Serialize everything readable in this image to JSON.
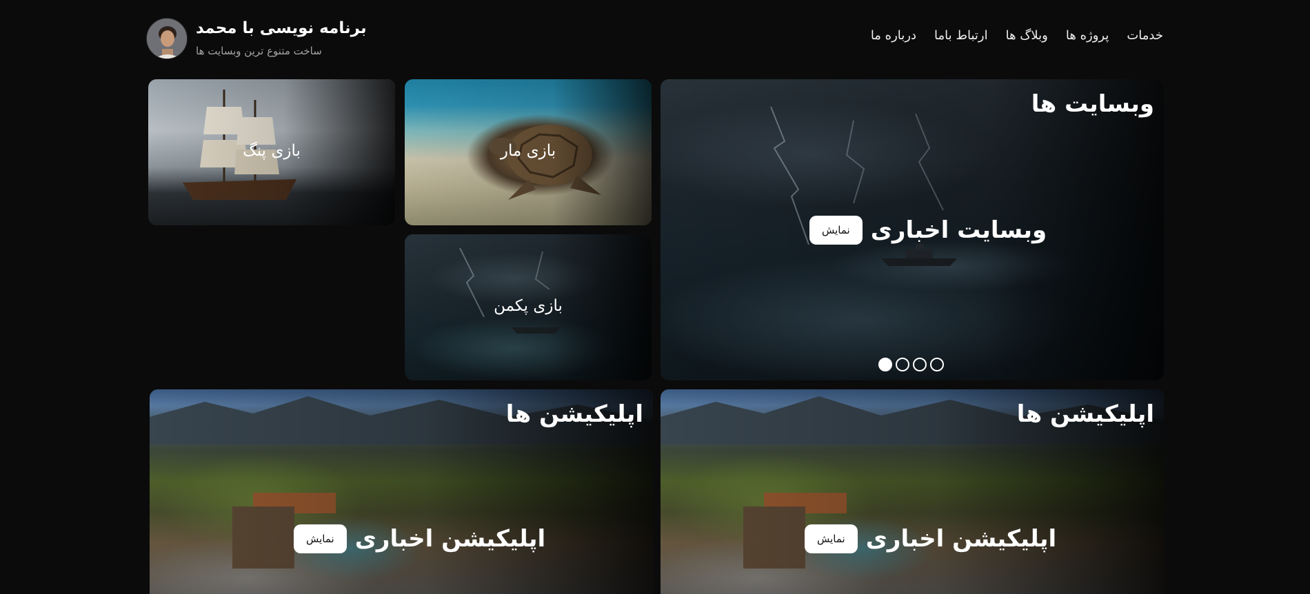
{
  "header": {
    "title": "برنامه نویسی با محمد",
    "subtitle": "ساخت متنوع ترین وبسایت ها",
    "nav": [
      {
        "label": "درباره ما"
      },
      {
        "label": "ارتباط باما"
      },
      {
        "label": "وبلاگ ها"
      },
      {
        "label": "پروژه ها"
      },
      {
        "label": "خدمات"
      }
    ]
  },
  "hero": {
    "heading": "وبسایت ها",
    "feature_title": "وبسایت اخباری",
    "button_label": "نمایش",
    "slide_count": 4,
    "active_slide": 1
  },
  "games": [
    {
      "label": "بازی مار"
    },
    {
      "label": "بازی پنگ"
    },
    {
      "label": "بازی پکمن"
    }
  ],
  "apps": [
    {
      "heading": "اپلیکیشن ها",
      "feature_title": "اپلیکیشن اخباری",
      "button_label": "نمایش"
    },
    {
      "heading": "اپلیکیشن ها",
      "feature_title": "اپلیکیشن اخباری",
      "button_label": "نمایش"
    }
  ],
  "colors": {
    "background": "#0b0b0b",
    "text": "#ffffff",
    "muted_text": "#a4a4a4",
    "button_bg": "#ffffff"
  }
}
